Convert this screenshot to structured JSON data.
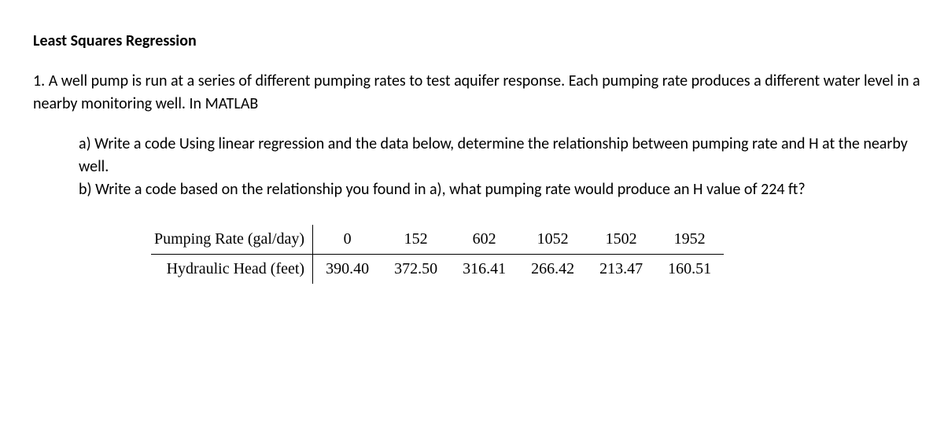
{
  "title": "Least Squares Regression",
  "problem_intro": "1.  A well pump is run at a series of different pumping rates to test aquifer response.  Each pumping rate produces a different water level in a nearby monitoring well. In MATLAB",
  "subpart_a": "a) Write a code Using linear regression and the data below, determine the relationship between pumping rate and H at the nearby well.",
  "subpart_b": "b) Write a code based on the relationship you found in a), what pumping rate would produce an H value of 224 ft?",
  "table": {
    "row1_label": "Pumping Rate (gal/day)",
    "row2_label": "Hydraulic Head (feet)",
    "row1": [
      "0",
      "152",
      "602",
      "1052",
      "1502",
      "1952"
    ],
    "row2": [
      "390.40",
      "372.50",
      "316.41",
      "266.42",
      "213.47",
      "160.51"
    ]
  },
  "chart_data": {
    "type": "table",
    "rows": [
      {
        "label": "Pumping Rate (gal/day)",
        "values": [
          0,
          152,
          602,
          1052,
          1502,
          1952
        ]
      },
      {
        "label": "Hydraulic Head (feet)",
        "values": [
          390.4,
          372.5,
          316.41,
          266.42,
          213.47,
          160.51
        ]
      }
    ]
  }
}
